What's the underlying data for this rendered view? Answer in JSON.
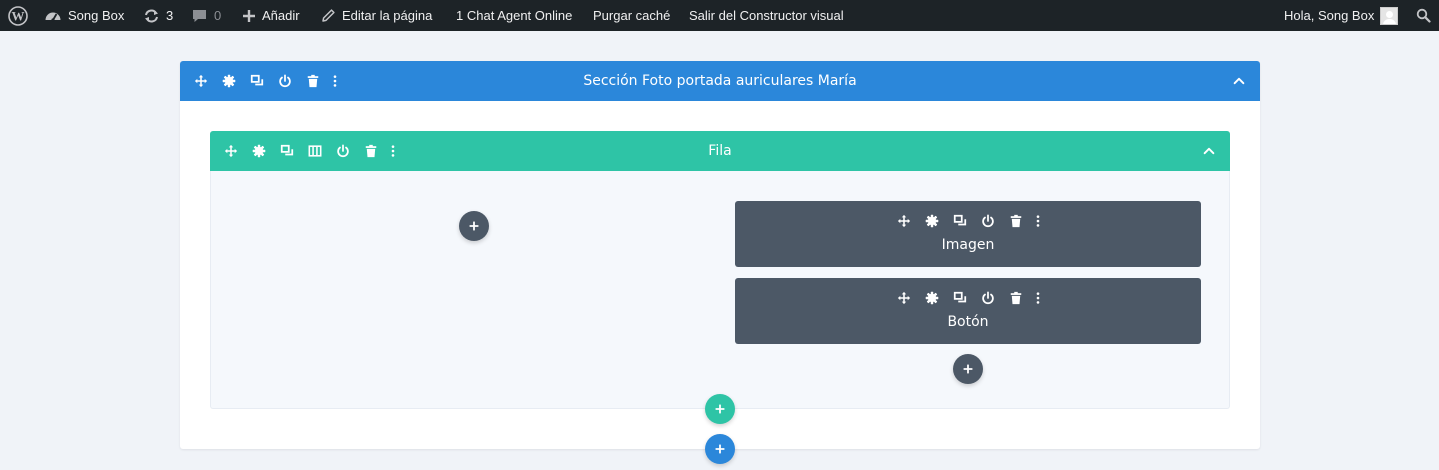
{
  "admin_bar": {
    "site_name": "Song Box",
    "updates_count": "3",
    "comments_count": "0",
    "add_new": "Añadir",
    "edit_page": "Editar la página",
    "chat": "1 Chat Agent Online",
    "purge_cache": "Purgar caché",
    "exit_builder": "Salir del Constructor visual",
    "greeting": "Hola, Song Box",
    "icons": [
      "wordpress-logo-icon",
      "dashboard-icon",
      "refresh-icon",
      "comment-icon",
      "plus-icon",
      "pencil-icon",
      "avatar",
      "search-icon"
    ]
  },
  "section": {
    "title": "Sección Foto portada auriculares María",
    "color": "#2b87da"
  },
  "row": {
    "title": "Fila",
    "color": "#2ec4a6"
  },
  "modules": [
    {
      "label": "Imagen"
    },
    {
      "label": "Botón"
    }
  ],
  "colors": {
    "module": "#4c5866",
    "add_module": "#4c5866",
    "add_row": "#2ec4a6",
    "add_section": "#2b87da",
    "admin_bar": "#1d2327",
    "canvas": "#f0f3f8"
  }
}
